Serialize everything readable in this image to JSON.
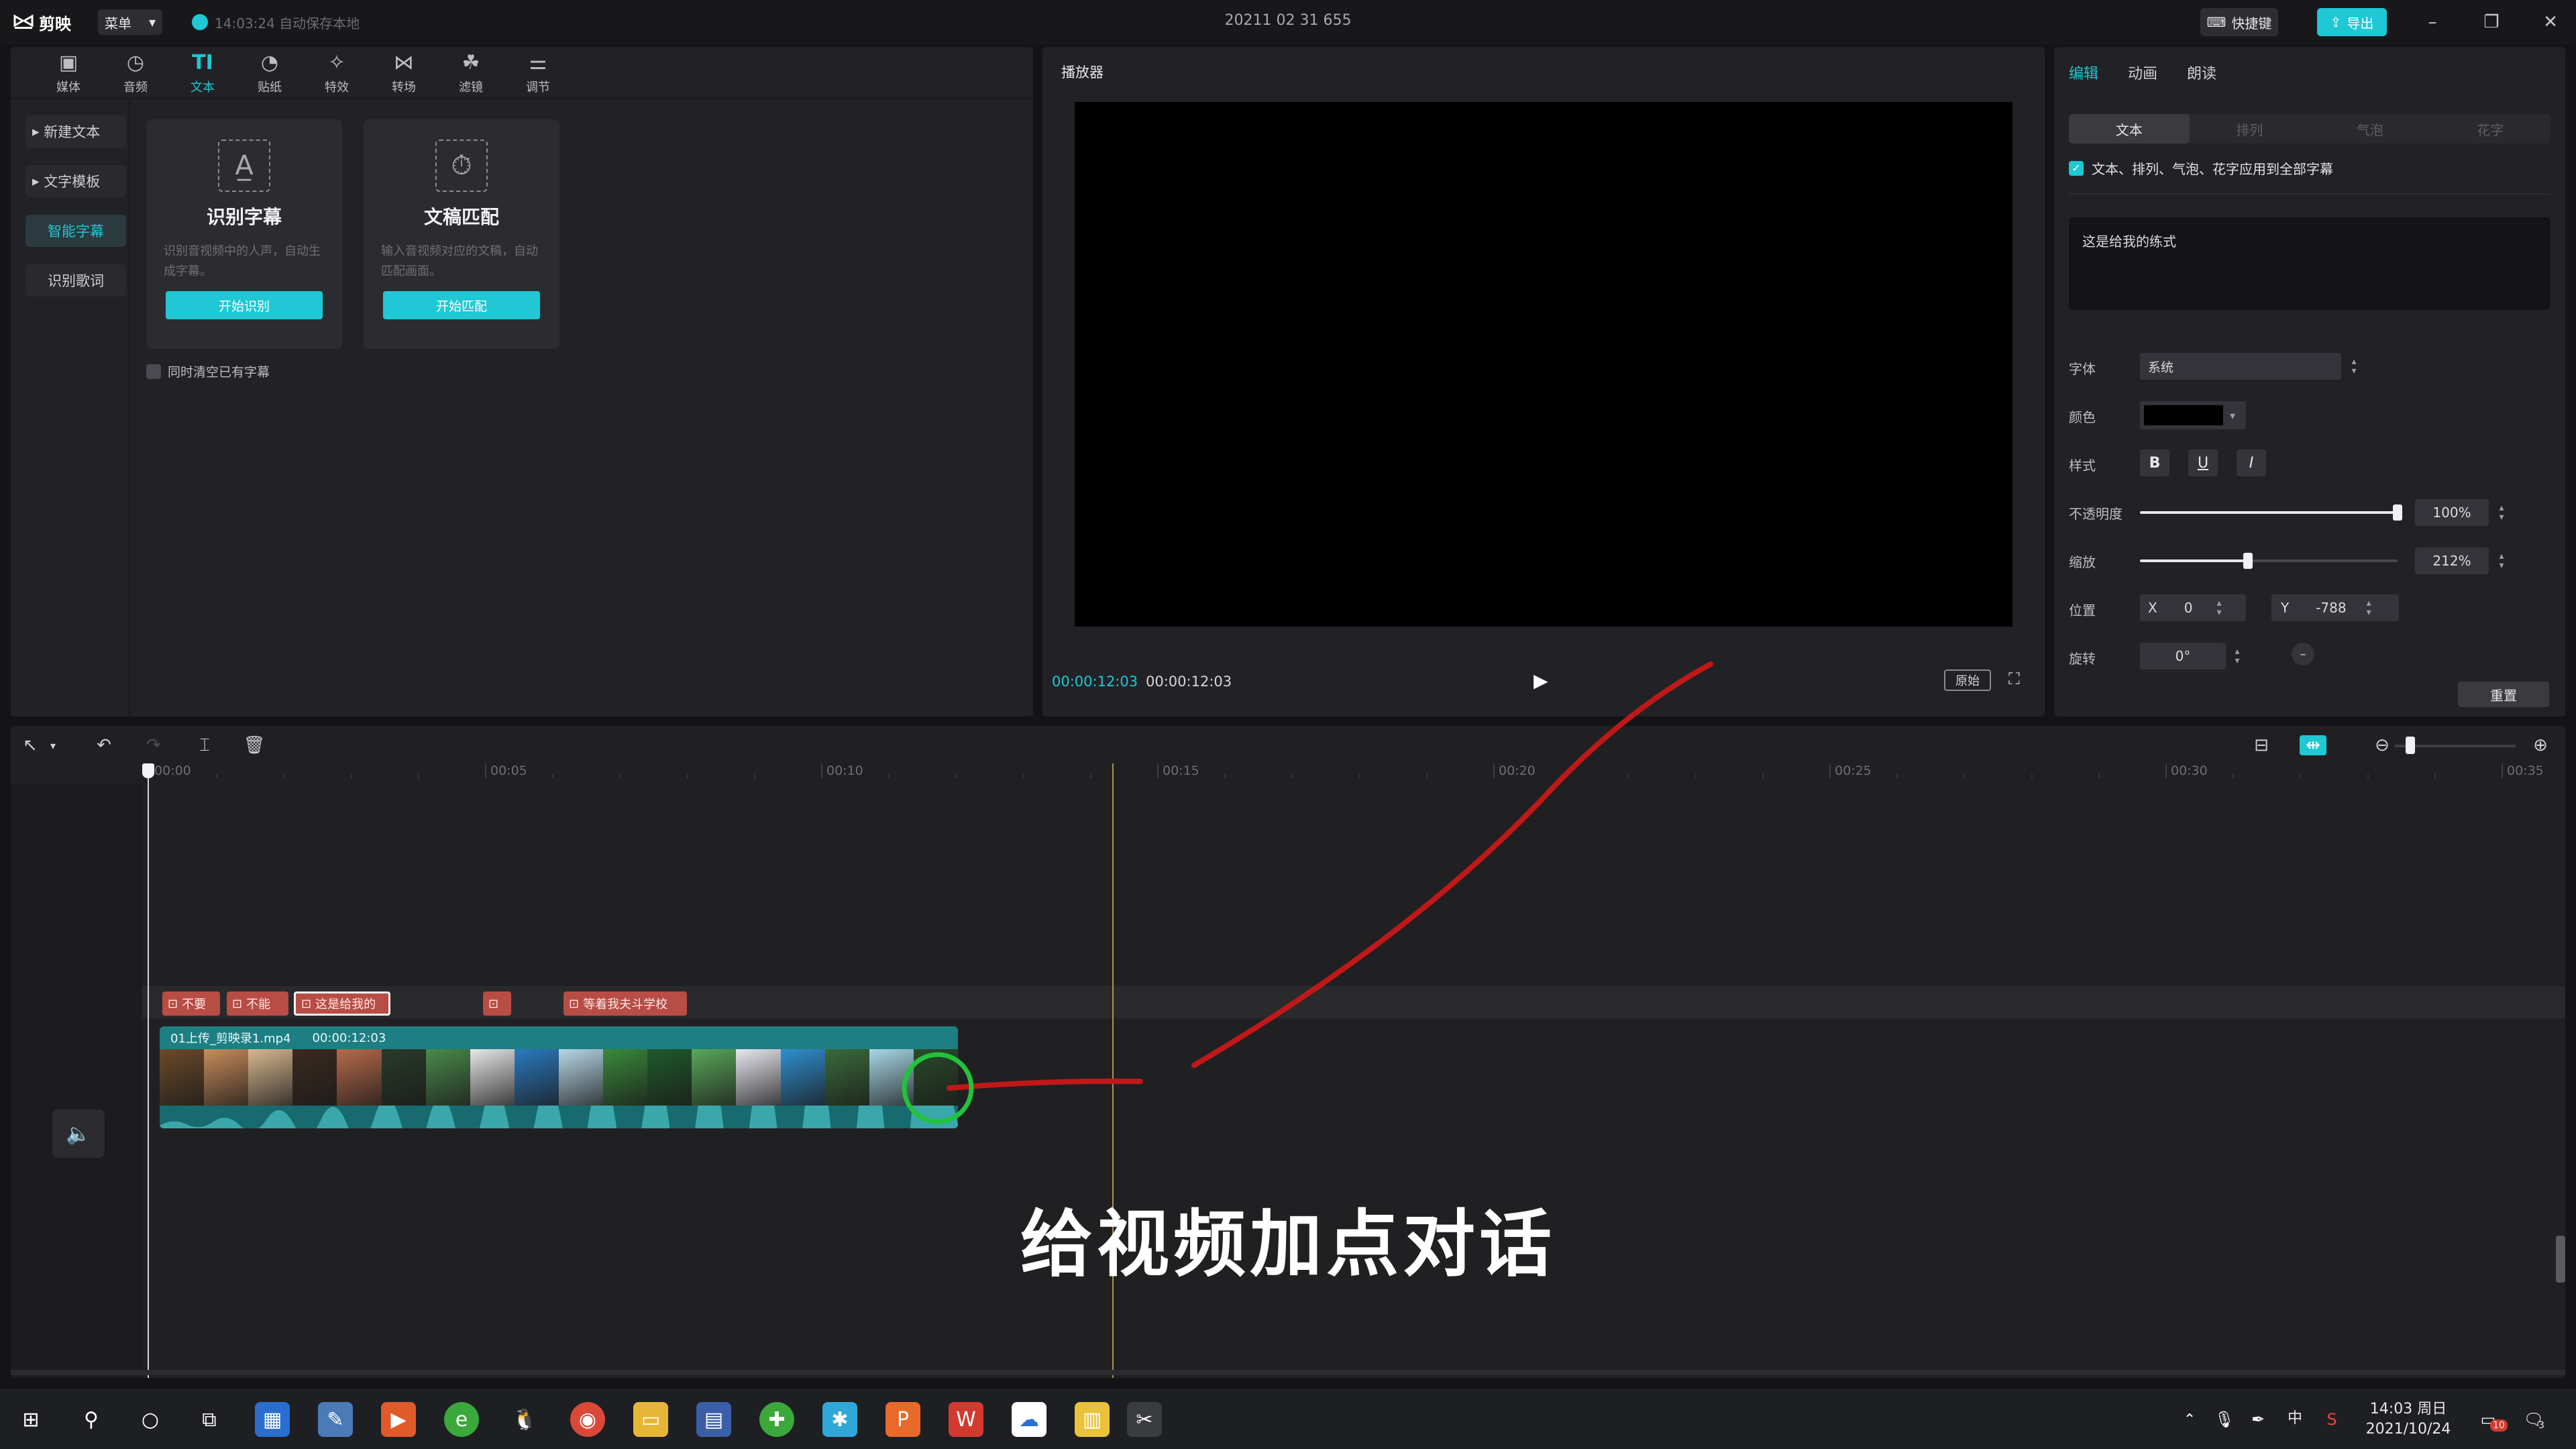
{
  "app": {
    "name": "剪映",
    "menu_label": "菜单",
    "autosave": "14:03:24 自动保存本地",
    "project_title": "20211 02 31 655",
    "shortcut_label": "快捷键",
    "export_label": "导出"
  },
  "toolbar": {
    "tools": [
      {
        "label": "媒体",
        "icon": "media-icon"
      },
      {
        "label": "音频",
        "icon": "audio-icon"
      },
      {
        "label": "文本",
        "icon": "text-icon"
      },
      {
        "label": "贴纸",
        "icon": "sticker-icon"
      },
      {
        "label": "特效",
        "icon": "effects-icon"
      },
      {
        "label": "转场",
        "icon": "transition-icon"
      },
      {
        "label": "滤镜",
        "icon": "filter-icon"
      },
      {
        "label": "调节",
        "icon": "adjust-icon"
      }
    ],
    "active_index": 2
  },
  "sidenav": {
    "items": [
      "新建文本",
      "文字模板",
      "智能字幕",
      "识别歌词"
    ],
    "active_index": 2
  },
  "smart_subtitle": {
    "recognize": {
      "title": "识别字幕",
      "desc": "识别音视频中的人声，自动生成字幕。",
      "button": "开始识别"
    },
    "match": {
      "title": "文稿匹配",
      "desc": "输入音视频对应的文稿，自动匹配画面。",
      "button": "开始匹配"
    },
    "clear_option": "同时清空已有字幕"
  },
  "player": {
    "title": "播放器",
    "time_current": "00:00:12:03",
    "time_total": "00:00:12:03",
    "original_label": "原始"
  },
  "inspector": {
    "tabs": [
      "编辑",
      "动画",
      "朗读"
    ],
    "active_tab": 0,
    "subtabs": [
      "文本",
      "排列",
      "气泡",
      "花字"
    ],
    "active_subtab": 0,
    "apply_all": "文本、排列、气泡、花字应用到全部字幕",
    "text_value": "这是给我的练式",
    "font_label": "字体",
    "font_value": "系统",
    "color_label": "颜色",
    "color_value": "#000000",
    "style_label": "样式",
    "style_buttons": [
      "B",
      "U",
      "I"
    ],
    "opacity_label": "不透明度",
    "opacity_value": "100%",
    "opacity_level": 1.0,
    "scale_label": "缩放",
    "scale_value": "212%",
    "scale_level": 0.42,
    "position_label": "位置",
    "pos_x_label": "X",
    "pos_x": "0",
    "pos_y_label": "Y",
    "pos_y": "-788",
    "rotation_label": "旋转",
    "rotation_value": "0°",
    "reset_label": "重置"
  },
  "timeline": {
    "ruler": [
      "00:00",
      "00:05",
      "00:10",
      "00:15",
      "00:20",
      "00:25",
      "00:30",
      "00:35"
    ],
    "text_clips": [
      {
        "label": "不要"
      },
      {
        "label": "不能"
      },
      {
        "label": "这是给我的"
      },
      {
        "label": ""
      },
      {
        "label": "等着我夫斗学校"
      }
    ],
    "video_clip": {
      "name": "01上传_剪映录1.mp4",
      "duration": "00:00:12:03"
    },
    "subtitle_overlay": "给视频加点对话"
  },
  "taskbar": {
    "time": "14:03 周日",
    "date": "2021/10/24",
    "ime": "中",
    "notif_count": "10",
    "action_center": "3"
  }
}
